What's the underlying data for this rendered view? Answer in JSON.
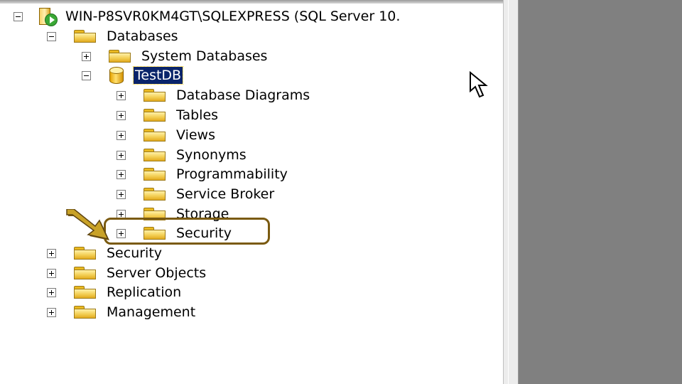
{
  "tree": {
    "server": "WIN-P8SVR0KM4GT\\SQLEXPRESS (SQL Server 10.",
    "databases": "Databases",
    "system_databases": "System Databases",
    "testdb": "TestDB",
    "db_children": [
      "Database Diagrams",
      "Tables",
      "Views",
      "Synonyms",
      "Programmability",
      "Service Broker",
      "Storage",
      "Security"
    ],
    "server_children": [
      "Security",
      "Server Objects",
      "Replication",
      "Management"
    ]
  },
  "colors": {
    "selection": "#0a246a",
    "highlight_border": "#7a5a10",
    "arrow": "#c9a227",
    "right_pane": "#808080"
  },
  "icons": {
    "server": "server-running-icon",
    "folder": "folder-icon",
    "database": "database-icon",
    "pointer": "mouse-pointer-icon",
    "callout": "arrow-callout-icon"
  }
}
